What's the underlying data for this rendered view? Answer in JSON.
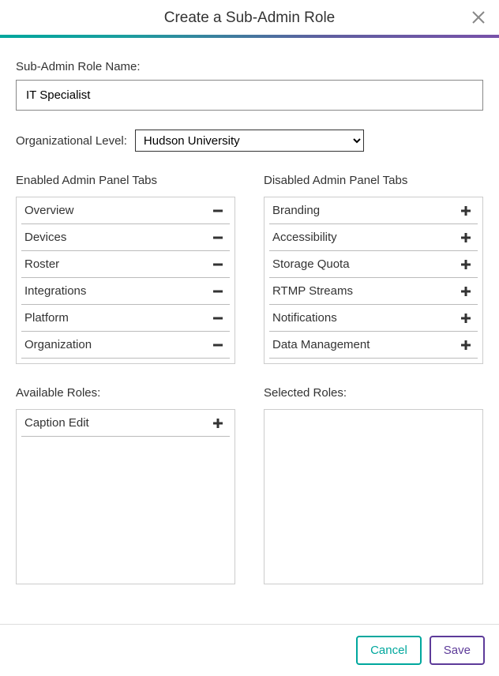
{
  "header": {
    "title": "Create a Sub-Admin Role"
  },
  "form": {
    "role_name_label": "Sub-Admin Role Name:",
    "role_name_value": "IT Specialist",
    "org_level_label": "Organizational Level:",
    "org_level_value": "Hudson University"
  },
  "tabs": {
    "enabled_heading": "Enabled Admin Panel Tabs",
    "disabled_heading": "Disabled Admin Panel Tabs",
    "enabled": [
      {
        "label": "Overview"
      },
      {
        "label": "Devices"
      },
      {
        "label": "Roster"
      },
      {
        "label": "Integrations"
      },
      {
        "label": "Platform"
      },
      {
        "label": "Organization"
      }
    ],
    "disabled": [
      {
        "label": "Branding"
      },
      {
        "label": "Accessibility"
      },
      {
        "label": "Storage Quota"
      },
      {
        "label": "RTMP Streams"
      },
      {
        "label": "Notifications"
      },
      {
        "label": "Data Management"
      }
    ]
  },
  "roles": {
    "available_heading": "Available Roles:",
    "selected_heading": "Selected Roles:",
    "available": [
      {
        "label": "Caption Edit"
      }
    ],
    "selected": []
  },
  "footer": {
    "cancel_label": "Cancel",
    "save_label": "Save"
  }
}
